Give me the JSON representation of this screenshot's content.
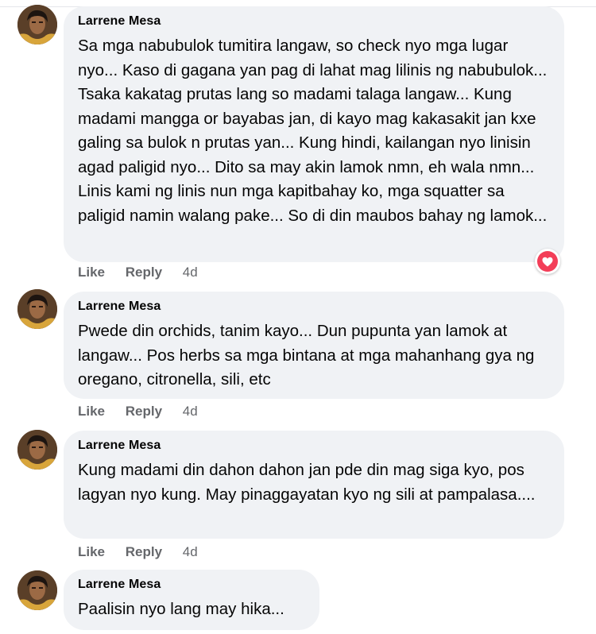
{
  "colors": {
    "bubble": "#f0f2f5",
    "meta_text": "#65676b",
    "love_reaction": "#f33e58"
  },
  "comments": [
    {
      "author": "Larrene Mesa",
      "text": "Sa mga nabubulok tumitira langaw, so check nyo mga lugar nyo... Kaso di gagana yan pag di lahat mag lilinis ng nabubulok... Tsaka kakatag prutas lang so madami talaga langaw... Kung madami mangga or bayabas jan, di kayo mag kakasakit jan kxe galing sa bulok n prutas yan... Kung hindi, kailangan nyo linisin agad paligid nyo... Dito sa may akin lamok nmn, eh wala nmn... Linis kami ng linis nun mga kapitbahay ko, mga squatter sa paligid namin walang pake... So di din maubos bahay ng lamok...",
      "like": "Like",
      "reply": "Reply",
      "time": "4d",
      "reaction_icon": "love-reaction-icon"
    },
    {
      "author": "Larrene Mesa",
      "text": "Pwede din orchids, tanim kayo... Dun pupunta yan lamok at langaw... Pos herbs sa mga bintana at mga mahanhang gya ng oregano, citronella, sili, etc",
      "like": "Like",
      "reply": "Reply",
      "time": "4d"
    },
    {
      "author": "Larrene Mesa",
      "text": "Kung madami din dahon dahon jan pde din mag siga kyo, pos lagyan nyo kung. May pinaggayatan kyo ng sili at pampalasa....",
      "like": "Like",
      "reply": "Reply",
      "time": "4d"
    },
    {
      "author": "Larrene Mesa",
      "text": "Paalisin nyo lang may hika..."
    }
  ]
}
